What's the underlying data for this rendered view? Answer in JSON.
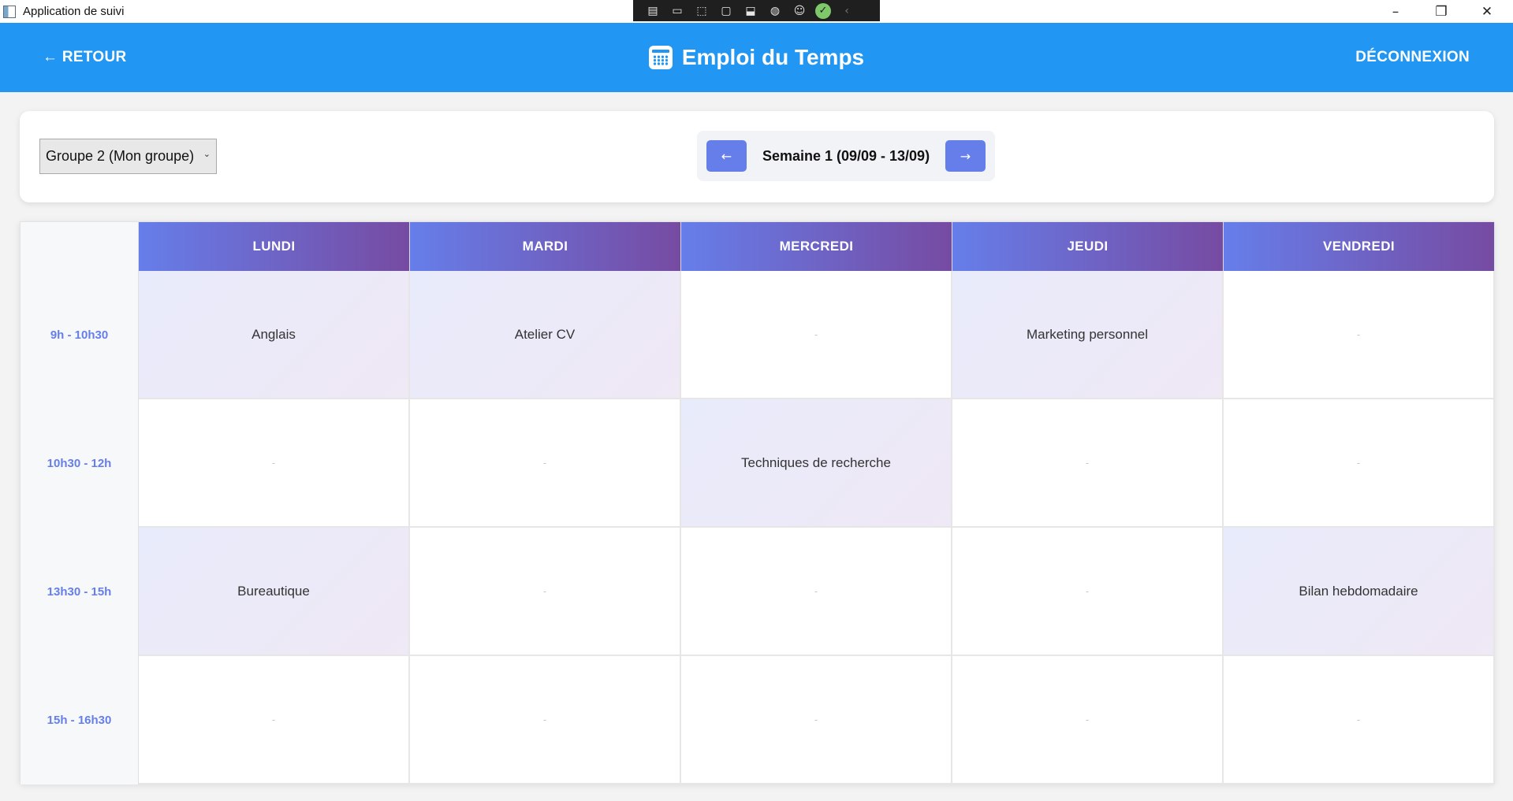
{
  "window": {
    "title": "Application de suivi"
  },
  "header": {
    "back_label": "← RETOUR",
    "title": "Emploi du Temps",
    "logout_label": "DÉCONNEXION"
  },
  "controls": {
    "group_selected": "Groupe 2 (Mon groupe)",
    "week_label": "Semaine 1 (09/09 - 13/09)",
    "prev_label": "←",
    "next_label": "→"
  },
  "timetable": {
    "days": [
      "LUNDI",
      "MARDI",
      "MERCREDI",
      "JEUDI",
      "VENDREDI"
    ],
    "times": [
      "9h - 10h30",
      "10h30 - 12h",
      "13h30 - 15h",
      "15h - 16h30"
    ],
    "rows": [
      [
        "Anglais",
        "Atelier CV",
        "-",
        "Marketing personnel",
        "-"
      ],
      [
        "-",
        "-",
        "Techniques de recherche",
        "-",
        "-"
      ],
      [
        "Bureautique",
        "-",
        "-",
        "-",
        "Bilan hebdomadaire"
      ],
      [
        "-",
        "-",
        "-",
        "-",
        "-"
      ]
    ]
  },
  "colors": {
    "header_bg": "#2196f3",
    "accent": "#667eea",
    "accent_end": "#764ba2"
  }
}
